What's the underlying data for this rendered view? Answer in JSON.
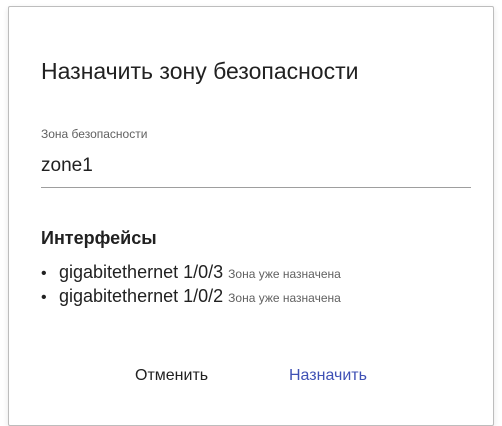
{
  "dialog": {
    "title": "Назначить зону безопасности",
    "zone_field": {
      "label": "Зона безопасности",
      "value": "zone1"
    },
    "interfaces": {
      "title": "Интерфейсы",
      "items": [
        {
          "name": "gigabitethernet 1/0/3",
          "note": "Зона уже назначена"
        },
        {
          "name": "gigabitethernet 1/0/2",
          "note": "Зона уже назначена"
        }
      ]
    },
    "buttons": {
      "cancel": "Отменить",
      "assign": "Назначить"
    }
  },
  "colors": {
    "primary": "#3f51b5",
    "text": "#212121",
    "secondary_text": "#616161"
  }
}
